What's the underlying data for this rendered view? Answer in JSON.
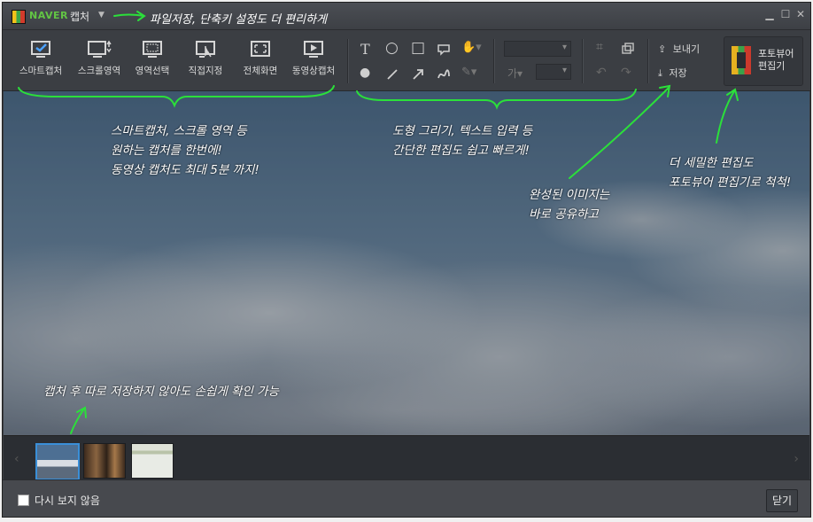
{
  "title_bar": {
    "brand": "NAVER",
    "app_name": "캡처",
    "controls": [
      "minimize",
      "maximize",
      "close"
    ]
  },
  "toolbar": {
    "capture_tools": [
      {
        "label": "스마트캡처",
        "icon": "smart-capture-icon"
      },
      {
        "label": "스크롤영역",
        "icon": "scroll-area-icon"
      },
      {
        "label": "영역선택",
        "icon": "area-select-icon"
      },
      {
        "label": "직접지정",
        "icon": "direct-select-icon"
      },
      {
        "label": "전체화면",
        "icon": "fullscreen-icon"
      },
      {
        "label": "동영상캡처",
        "icon": "video-capture-icon"
      }
    ],
    "share_label": "보내기",
    "save_label": "저장",
    "photo_editor_label_line1": "포토뷰어",
    "photo_editor_label_line2": "편집기"
  },
  "annotations": {
    "title_tip": "파일저장, 단축키 설정도 더 편리하게",
    "capture_tip_line1": "스마트캡처, 스크롤 영역 등",
    "capture_tip_line2": "원하는 캡처를 한번에!",
    "capture_tip_line3": "동영상 캡처도 최대 5분 까지!",
    "edit_tip_line1": "도형 그리기, 텍스트 입력 등",
    "edit_tip_line2": "간단한 편집도 쉽고 빠르게!",
    "share_tip_line1": "완성된 이미지는",
    "share_tip_line2": "바로 공유하고",
    "photo_tip_line1": "더 세밀한 편집도",
    "photo_tip_line2": "포토뷰어 편집기로 척척!",
    "history_tip": "캡처 후 따로 저장하지 않아도 손쉽게 확인 가능"
  },
  "footer": {
    "dont_show_label": "다시 보지 않음",
    "close_label": "닫기"
  },
  "colors": {
    "accent_green": "#2be03a",
    "brand_green": "#62c444",
    "selection_blue": "#3a8fd8"
  }
}
